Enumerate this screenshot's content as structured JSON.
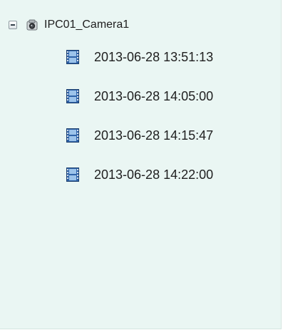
{
  "tree": {
    "root": {
      "label": "IPC01_Camera1",
      "icon": "camera-icon",
      "expanded": true
    },
    "recordings": [
      {
        "label": "2013-06-28 13:51:13",
        "icon": "video-file-icon"
      },
      {
        "label": "2013-06-28 14:05:00",
        "icon": "video-file-icon"
      },
      {
        "label": "2013-06-28 14:15:47",
        "icon": "video-file-icon"
      },
      {
        "label": "2013-06-28 14:22:00",
        "icon": "video-file-icon"
      }
    ]
  },
  "colors": {
    "panel_background": "#eaf6f3",
    "text": "#202020",
    "film_blue": "#2f63a8"
  }
}
